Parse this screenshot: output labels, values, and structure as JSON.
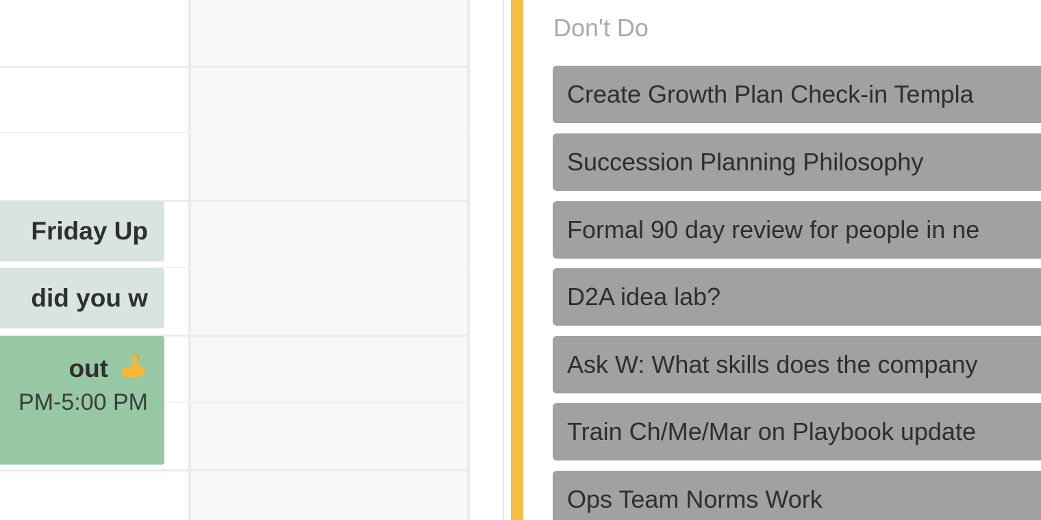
{
  "calendar": {
    "events": [
      {
        "title": "Friday Up",
        "time": "",
        "color": "#d8e4e0"
      },
      {
        "title": "did you w",
        "time": "",
        "color": "#d8e4e0"
      },
      {
        "title": "out",
        "time": "PM-5:00 PM",
        "icon": "flexed-biceps-icon",
        "color": "#96c9a3"
      }
    ]
  },
  "list": {
    "title": "Don't Do",
    "accent_color": "#f5bd42",
    "card_color": "#a1a1a4",
    "cards": [
      {
        "label": "Create Growth Plan Check-in Templa"
      },
      {
        "label": "Succession Planning Philosophy"
      },
      {
        "label": "Formal 90 day review for people in ne"
      },
      {
        "label": "D2A idea lab?"
      },
      {
        "label": "Ask W: What skills does the company"
      },
      {
        "label": "Train Ch/Me/Mar on Playbook update"
      },
      {
        "label": "Ops Team Norms Work"
      }
    ]
  }
}
